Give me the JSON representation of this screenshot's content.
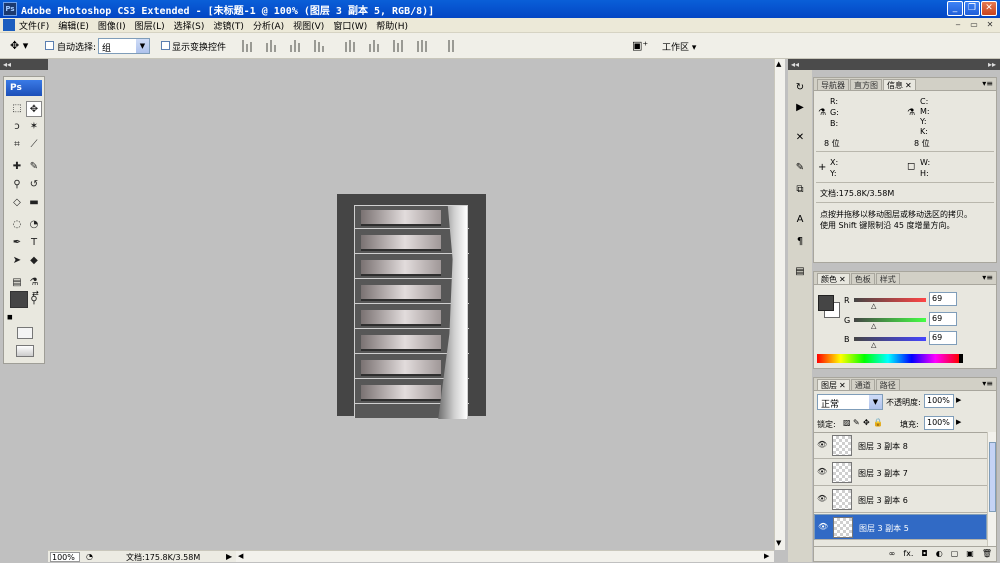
{
  "window": {
    "title": "Adobe Photoshop CS3 Extended - [未标题-1 @ 100% (图层 3 副本 5, RGB/8)]",
    "app_icon": "Ps",
    "btn_min": "_",
    "btn_max": "❐",
    "btn_close": "✕"
  },
  "menu": {
    "items": [
      "文件(F)",
      "编辑(E)",
      "图像(I)",
      "图层(L)",
      "选择(S)",
      "滤镜(T)",
      "分析(A)",
      "视图(V)",
      "窗口(W)",
      "帮助(H)"
    ],
    "mdi_min": "‒",
    "mdi_restore": "▭",
    "mdi_close": "✕"
  },
  "options": {
    "auto_select_label": "自动选择:",
    "auto_select_value": "组",
    "show_transform_label": "显示变换控件",
    "workspace_label": "工作区 ▾"
  },
  "toolbox": {
    "logo": "Ps",
    "tools": [
      {
        "name": "marquee-tool",
        "glyph": "⬚"
      },
      {
        "name": "move-tool",
        "glyph": "✥"
      },
      {
        "name": "lasso-tool",
        "glyph": "ↄ"
      },
      {
        "name": "magic-wand-tool",
        "glyph": "✶"
      },
      {
        "name": "crop-tool",
        "glyph": "⌗"
      },
      {
        "name": "slice-tool",
        "glyph": "⟋"
      },
      {
        "name": "healing-tool",
        "glyph": "✚"
      },
      {
        "name": "brush-tool",
        "glyph": "✎"
      },
      {
        "name": "stamp-tool",
        "glyph": "⚲"
      },
      {
        "name": "history-brush-tool",
        "glyph": "↺"
      },
      {
        "name": "eraser-tool",
        "glyph": "◇"
      },
      {
        "name": "gradient-tool",
        "glyph": "▬"
      },
      {
        "name": "blur-tool",
        "glyph": "◌"
      },
      {
        "name": "dodge-tool",
        "glyph": "◔"
      },
      {
        "name": "pen-tool",
        "glyph": "✒"
      },
      {
        "name": "type-tool",
        "glyph": "T"
      },
      {
        "name": "path-select-tool",
        "glyph": "➤"
      },
      {
        "name": "shape-tool",
        "glyph": "◆"
      },
      {
        "name": "notes-tool",
        "glyph": "▤"
      },
      {
        "name": "eyedropper-tool",
        "glyph": "⚗"
      },
      {
        "name": "hand-tool",
        "glyph": "✋"
      },
      {
        "name": "zoom-tool",
        "glyph": "⚲"
      }
    ]
  },
  "status": {
    "zoom": "100%",
    "doc_info": "文档:175.8K/3.58M"
  },
  "info_panel": {
    "tabs": [
      "导航器",
      "直方图",
      "信息"
    ],
    "rgb_labels": [
      "R:",
      "G:",
      "B:"
    ],
    "cmyk_labels": [
      "C:",
      "M:",
      "Y:",
      "K:"
    ],
    "bit_left": "8 位",
    "bit_right": "8 位",
    "xy_labels": [
      "X:",
      "Y:"
    ],
    "wh_labels": [
      "W:",
      "H:"
    ],
    "doc_info": "文档:175.8K/3.58M",
    "hint_line1": "点按并拖移以移动图层或移动选区的拷贝。",
    "hint_line2": "使用 Shift 键限制沿 45 度增量方向。"
  },
  "color_panel": {
    "tabs": [
      "颜色",
      "色板",
      "样式"
    ],
    "channels": [
      {
        "label": "R",
        "value": "69"
      },
      {
        "label": "G",
        "value": "69"
      },
      {
        "label": "B",
        "value": "69"
      }
    ],
    "fg_color": "#454545"
  },
  "layers_panel": {
    "tabs": [
      "图层",
      "通道",
      "路径"
    ],
    "blend_mode": "正常",
    "opacity_label": "不透明度:",
    "opacity_value": "100%",
    "lock_label": "锁定:",
    "fill_label": "填充:",
    "fill_value": "100%",
    "layers": [
      {
        "name": "图层 3 副本 8",
        "visible": true,
        "selected": false
      },
      {
        "name": "图层 3 副本 7",
        "visible": true,
        "selected": false
      },
      {
        "name": "图层 3 副本 6",
        "visible": true,
        "selected": false
      },
      {
        "name": "图层 3 副本 5",
        "visible": true,
        "selected": true
      }
    ],
    "footer_icons": [
      "link-icon",
      "fx-icon",
      "mask-icon",
      "adjustment-icon",
      "group-icon",
      "new-layer-icon",
      "trash-icon"
    ],
    "footer_glyphs": [
      "∞",
      "fx.",
      "◘",
      "◐",
      "▢",
      "▣",
      "🗑"
    ]
  }
}
